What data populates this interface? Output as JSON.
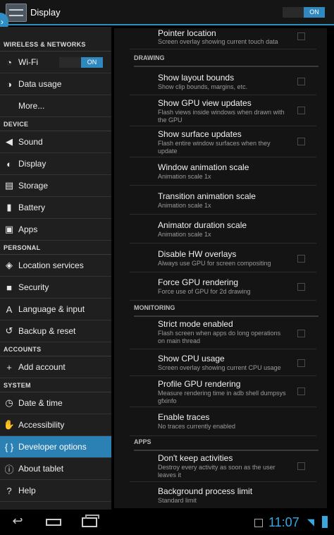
{
  "actionbar": {
    "title": "Display",
    "toggle_label": "ON"
  },
  "sidebar": {
    "wireless_header": "WIRELESS & NETWORKS",
    "wifi": "Wi-Fi",
    "wifi_toggle": "ON",
    "data_usage": "Data usage",
    "more": "More...",
    "device_header": "DEVICE",
    "sound": "Sound",
    "display": "Display",
    "storage": "Storage",
    "battery": "Battery",
    "apps": "Apps",
    "personal_header": "PERSONAL",
    "location": "Location services",
    "security": "Security",
    "language": "Language & input",
    "backup": "Backup & reset",
    "accounts_header": "ACCOUNTS",
    "add_account": "Add account",
    "system_header": "SYSTEM",
    "date_time": "Date & time",
    "accessibility": "Accessibility",
    "developer": "Developer options",
    "about": "About tablet",
    "help": "Help"
  },
  "prefs": {
    "pointer_location": {
      "title": "Pointer location",
      "summary": "Screen overlay showing current touch data"
    },
    "drawing_header": "DRAWING",
    "layout_bounds": {
      "title": "Show layout bounds",
      "summary": "Show clip bounds, margins, etc."
    },
    "gpu_view_updates": {
      "title": "Show GPU view updates",
      "summary": "Flash views inside windows when drawn with the GPU"
    },
    "surface_updates": {
      "title": "Show surface updates",
      "summary": "Flash entire window surfaces when they update"
    },
    "window_anim": {
      "title": "Window animation scale",
      "summary": "Animation scale 1x"
    },
    "transition_anim": {
      "title": "Transition animation scale",
      "summary": "Animation scale 1x"
    },
    "animator_duration": {
      "title": "Animator duration scale",
      "summary": "Animation scale 1x"
    },
    "hw_overlays": {
      "title": "Disable HW overlays",
      "summary": "Always use GPU for screen compositing"
    },
    "force_gpu": {
      "title": "Force GPU rendering",
      "summary": "Force use of GPU for 2d drawing"
    },
    "monitoring_header": "MONITORING",
    "strict_mode": {
      "title": "Strict mode enabled",
      "summary": "Flash screen when apps do long operations on main thread"
    },
    "cpu_usage": {
      "title": "Show CPU usage",
      "summary": "Screen overlay showing current CPU usage"
    },
    "profile_gpu": {
      "title": "Profile GPU rendering",
      "summary": "Measure rendering time in adb shell dumpsys gfxinfo"
    },
    "enable_traces": {
      "title": "Enable traces",
      "summary": "No traces currently enabled"
    },
    "apps_header": "APPS",
    "dont_keep": {
      "title": "Don't keep activities",
      "summary": "Destroy every activity as soon as the user leaves it"
    },
    "bg_limit": {
      "title": "Background process limit",
      "summary": "Standard limit"
    }
  },
  "statusbar": {
    "clock": "11:07"
  },
  "colors": {
    "accent": "#2e8ec4",
    "selected": "#2b81b3",
    "clock": "#3aa6e0"
  }
}
